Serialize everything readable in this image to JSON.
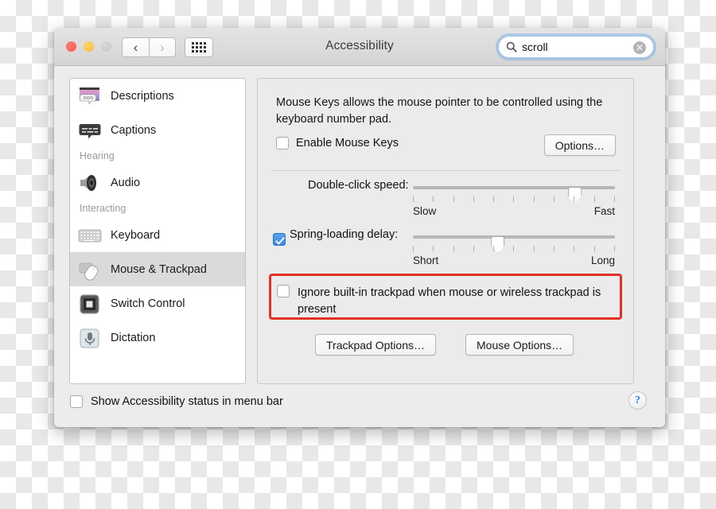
{
  "window": {
    "title": "Accessibility",
    "traffic_lights": [
      "close",
      "minimize",
      "zoom"
    ],
    "nav": {
      "back": "‹",
      "forward": "›"
    },
    "grid_button": "show-all-icon"
  },
  "search": {
    "value": "scroll",
    "placeholder": "Search",
    "icon": "search-icon",
    "clear_icon": "✕"
  },
  "sidebar": {
    "items": [
      {
        "type": "item",
        "label": "Descriptions",
        "icon": "descriptions-icon",
        "selected": false
      },
      {
        "type": "item",
        "label": "Captions",
        "icon": "captions-icon",
        "selected": false
      },
      {
        "type": "header",
        "label": "Hearing"
      },
      {
        "type": "item",
        "label": "Audio",
        "icon": "audio-speaker-icon",
        "selected": false
      },
      {
        "type": "header",
        "label": "Interacting"
      },
      {
        "type": "item",
        "label": "Keyboard",
        "icon": "keyboard-icon",
        "selected": false
      },
      {
        "type": "item",
        "label": "Mouse & Trackpad",
        "icon": "mouse-trackpad-icon",
        "selected": true
      },
      {
        "type": "item",
        "label": "Switch Control",
        "icon": "switch-control-icon",
        "selected": false
      },
      {
        "type": "item",
        "label": "Dictation",
        "icon": "dictation-mic-icon",
        "selected": false
      }
    ]
  },
  "content": {
    "description": "Mouse Keys allows the mouse pointer to be controlled using the keyboard number pad.",
    "enable_mouse_keys": {
      "label": "Enable Mouse Keys",
      "checked": false
    },
    "options_button": "Options…",
    "sliders": [
      {
        "label": "Double-click speed:",
        "min_label": "Slow",
        "max_label": "Fast",
        "ticks": 11,
        "value_percent": 80,
        "has_checkbox": false
      },
      {
        "label": "Spring-loading delay:",
        "min_label": "Short",
        "max_label": "Long",
        "ticks": 11,
        "value_percent": 42,
        "has_checkbox": true,
        "checked": true
      }
    ],
    "ignore_trackpad": {
      "label": "Ignore built-in trackpad when mouse or wireless trackpad is present",
      "checked": false,
      "highlight_color": "#e33126"
    },
    "trackpad_options_button": "Trackpad Options…",
    "mouse_options_button": "Mouse Options…"
  },
  "footer": {
    "show_status": {
      "label": "Show Accessibility status in menu bar",
      "checked": false
    },
    "help_button": "?"
  }
}
